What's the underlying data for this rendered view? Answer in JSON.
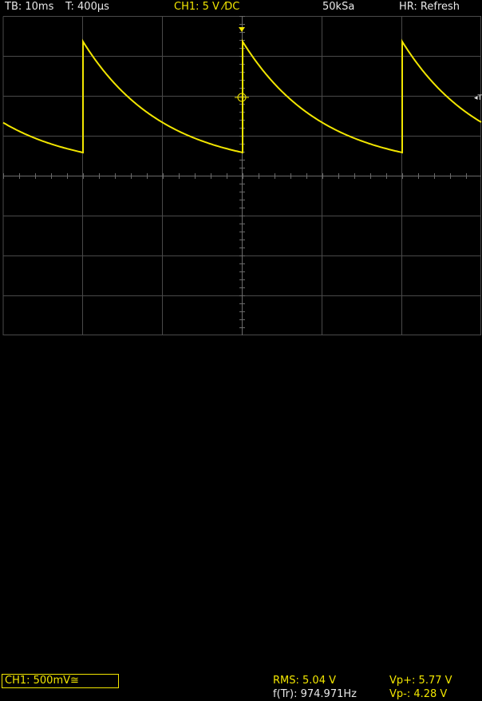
{
  "header": {
    "timebase": "TB: 10ms",
    "trigger_time": "T: 400µs",
    "channel": "CH1: 5 V ⁄DC",
    "sample_rate": "50kSa",
    "mode": "HR: Refresh"
  },
  "footer": {
    "channel_scale": "CH1: 500mV≅",
    "rms": "RMS: 5.04 V",
    "freq": "f(Tr): 974.971Hz",
    "vp_plus": "Vp+: 5.77 V",
    "vp_minus": "Vp-: 4.28 V"
  },
  "markers": {
    "trigger_level": "◂T"
  },
  "colors": {
    "trace": "#f2e600",
    "grid": "#4a4a4a",
    "text": "#e8e8e8",
    "background": "#000000"
  }
}
